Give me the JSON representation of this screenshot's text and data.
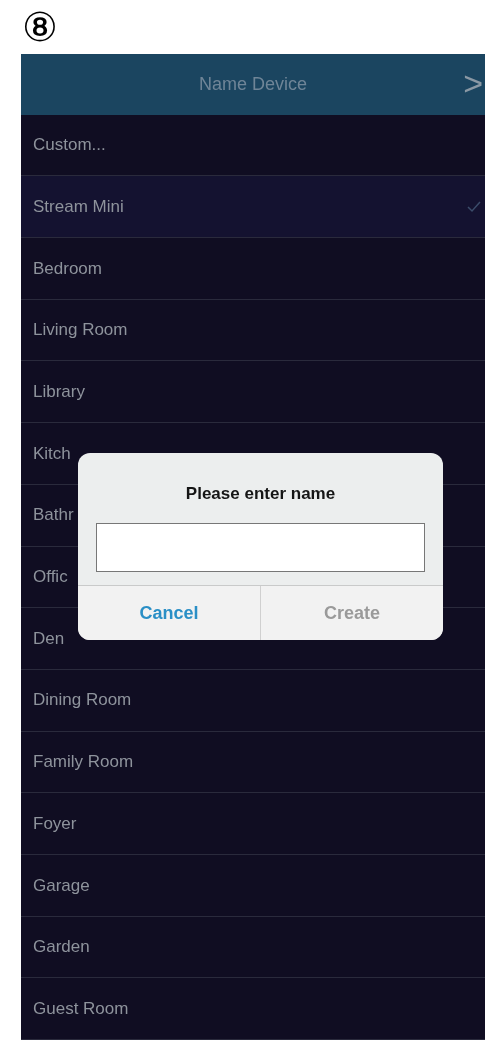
{
  "step_marker": "⑧",
  "header": {
    "title": "Name Device",
    "next": ">"
  },
  "rows": [
    {
      "label": "Custom...",
      "selected": false
    },
    {
      "label": "Stream Mini",
      "selected": true
    },
    {
      "label": "Bedroom",
      "selected": false
    },
    {
      "label": "Living Room",
      "selected": false
    },
    {
      "label": "Library",
      "selected": false
    },
    {
      "label": "Kitch",
      "selected": false
    },
    {
      "label": "Bathr",
      "selected": false
    },
    {
      "label": "Offic",
      "selected": false
    },
    {
      "label": "Den",
      "selected": false
    },
    {
      "label": "Dining Room",
      "selected": false
    },
    {
      "label": "Family Room",
      "selected": false
    },
    {
      "label": "Foyer",
      "selected": false
    },
    {
      "label": "Garage",
      "selected": false
    },
    {
      "label": "Garden",
      "selected": false
    },
    {
      "label": "Guest Room",
      "selected": false
    }
  ],
  "dialog": {
    "title": "Please enter name",
    "buttons": [
      {
        "label": "Cancel",
        "disabled": false
      },
      {
        "label": "Create",
        "disabled": true
      }
    ]
  }
}
